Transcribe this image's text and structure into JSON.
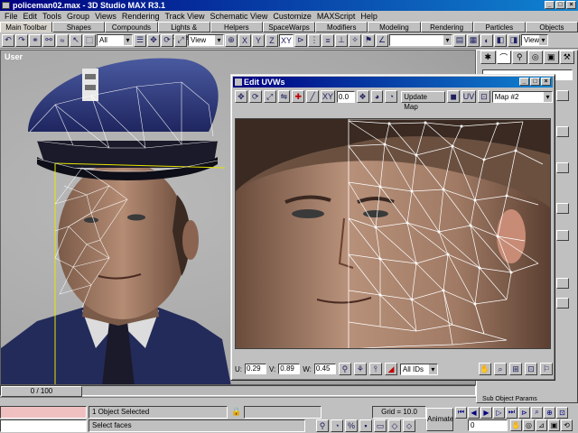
{
  "window": {
    "title": "policeman02.max - 3D Studio MAX R3.1"
  },
  "menu": [
    "File",
    "Edit",
    "Tools",
    "Group",
    "Views",
    "Rendering",
    "Track View",
    "Schematic View",
    "Customize",
    "MAXScript",
    "Help"
  ],
  "tabs": [
    "Main Toolbar",
    "Shapes",
    "Compounds",
    "Lights & Cameras",
    "Helpers",
    "SpaceWarps",
    "Modifiers",
    "Modeling",
    "Rendering",
    "Particles",
    "Objects"
  ],
  "toolbar": {
    "selection_filter": "All",
    "reference_coord": "View",
    "axis_x": "X",
    "axis_y": "Y",
    "axis_z": "Z",
    "axis_xy": "XY",
    "named_selection": "",
    "right_view": "View"
  },
  "viewport": {
    "label": "User"
  },
  "uvw": {
    "title": "Edit UVWs",
    "xy_label": "XY",
    "spinner_value": "0.0",
    "update_map": "Update Map",
    "uv_label": "UV",
    "map_select": "Map #2",
    "u_label": "U:",
    "u_value": "0.29",
    "v_label": "V:",
    "v_value": "0.89",
    "w_label": "W:",
    "w_value": "0.45",
    "ids_select": "All IDs"
  },
  "command_panel": {
    "name_field": "",
    "subobj_label": "Sub Object Params"
  },
  "time_slider": {
    "label": "0 / 100"
  },
  "status": {
    "selection": "1 Object Selected",
    "prompt": "Select faces",
    "grid": "Grid = 10.0",
    "animate": "Animate",
    "frame": "0"
  }
}
